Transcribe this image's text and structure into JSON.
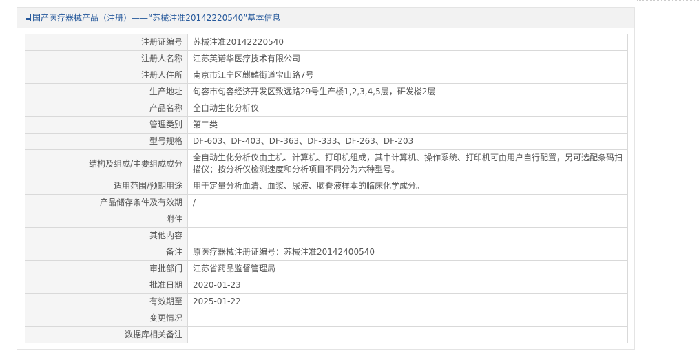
{
  "panel": {
    "title": "国产医疗器械产品（注册）——“苏械注准20142220540”基本信息"
  },
  "rows": [
    {
      "label": "注册证编号",
      "value": "苏械注准20142220540"
    },
    {
      "label": "注册人名称",
      "value": "江苏英诺华医疗技术有限公司"
    },
    {
      "label": "注册人住所",
      "value": "南京市江宁区麒麟街道宝山路7号"
    },
    {
      "label": "生产地址",
      "value": "句容市句容经济开发区致远路29号生产楼1,2,3,4,5层，研发楼2层"
    },
    {
      "label": "产品名称",
      "value": "全自动生化分析仪"
    },
    {
      "label": "管理类别",
      "value": "第二类"
    },
    {
      "label": "型号规格",
      "value": "DF-603、DF-403、DF-363、DF-333、DF-263、DF-203"
    },
    {
      "label": "结构及组成/主要组成成分",
      "value": "全自动生化分析仪由主机、计算机、打印机组成，其中计算机、操作系统、打印机可由用户自行配置，另可选配条码扫描仪；按分析仪检测速度和分析项目不同分为六种型号。"
    },
    {
      "label": "适用范围/预期用途",
      "value": "用于定量分析血清、血浆、尿液、脑脊液样本的临床化学成分。"
    },
    {
      "label": "产品储存条件及有效期",
      "value": "/"
    },
    {
      "label": "附件",
      "value": ""
    },
    {
      "label": "其他内容",
      "value": ""
    },
    {
      "label": "备注",
      "value": "原医疗器械注册证编号：苏械注准20142400540"
    },
    {
      "label": "审批部门",
      "value": "江苏省药品监督管理局"
    },
    {
      "label": "批准日期",
      "value": "2020-01-23"
    },
    {
      "label": "有效期至",
      "value": "2025-01-22"
    },
    {
      "label": "变更情况",
      "value": ""
    },
    {
      "label": "数据库相关备注",
      "value": ""
    }
  ]
}
